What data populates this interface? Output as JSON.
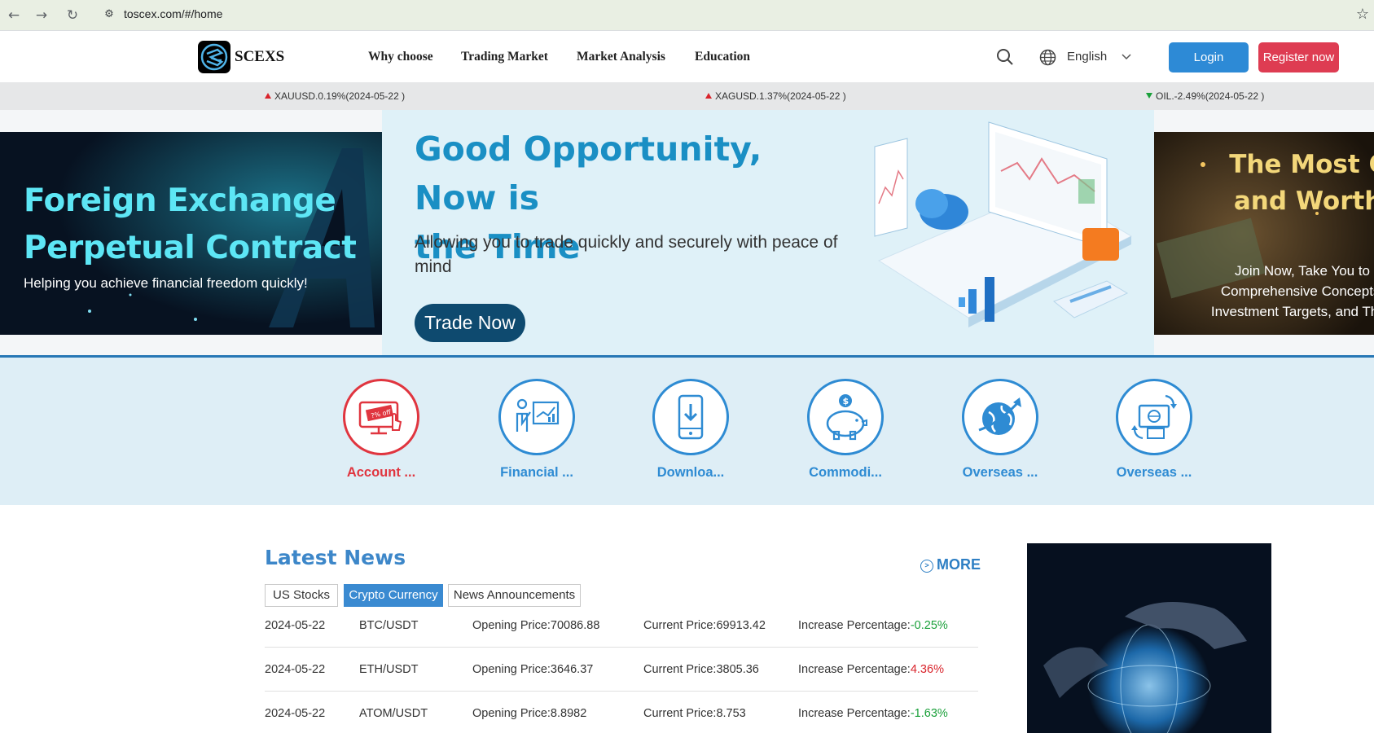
{
  "browser": {
    "url": "toscex.com/#/home",
    "back_icon": "back-arrow-icon",
    "forward_icon": "forward-arrow-icon",
    "reload_icon": "reload-icon",
    "site_info_icon": "tune-icon",
    "bookmark_icon": "star-icon"
  },
  "header": {
    "logo_text": "SCEXS",
    "nav": [
      "Why choose",
      "Trading Market",
      "Market Analysis",
      "Education"
    ],
    "language": "English",
    "login_label": "Login",
    "register_label": "Register now",
    "colors": {
      "login": "#2d8ad6",
      "register": "#de3c52"
    }
  },
  "ticker": [
    {
      "text": "XAUUSD.0.19%(2024-05-22 )",
      "direction": "up"
    },
    {
      "text": "XAGUSD.1.37%(2024-05-22 )",
      "direction": "up"
    },
    {
      "text": "OIL.-2.49%(2024-05-22 )",
      "direction": "down"
    }
  ],
  "banners": {
    "left": {
      "title_line1": "Foreign Exchange",
      "title_line2": "Perpetual Contract",
      "subtitle": "Helping you achieve financial freedom quickly!"
    },
    "center": {
      "title_line1": "Good Opportunity, Now is",
      "title_line2": "the Time",
      "subtitle": "Allowing you to trade quickly and securely with peace of mind",
      "button": "Trade Now"
    },
    "right": {
      "title_line1": "The Most Com",
      "title_line2": "and Worthy C",
      "sub_line1": "Join Now, Take You to",
      "sub_line2": "Comprehensive Concepts,",
      "sub_line3": "Investment Targets, and Their"
    }
  },
  "quick_links": [
    {
      "label": "Account ...",
      "icon": "discount-screen-icon",
      "color": "#e0353f"
    },
    {
      "label": "Financial ...",
      "icon": "presentation-chart-icon",
      "color": "#2e8bd3"
    },
    {
      "label": "Downloa...",
      "icon": "mobile-download-icon",
      "color": "#2e8bd3"
    },
    {
      "label": "Commodi...",
      "icon": "piggy-bank-icon",
      "color": "#2e8bd3"
    },
    {
      "label": "Overseas ...",
      "icon": "globe-arrow-icon",
      "color": "#2e8bd3"
    },
    {
      "label": "Overseas ...",
      "icon": "money-exchange-icon",
      "color": "#2e8bd3"
    }
  ],
  "news": {
    "title": "Latest News",
    "more": "MORE",
    "tabs": [
      "US Stocks",
      "Crypto Currency",
      "News Announcements"
    ],
    "active_tab": "Crypto Currency",
    "rows": [
      {
        "date": "2024-05-22",
        "pair": "BTC/USDT",
        "open": "Opening Price:70086.88",
        "current": "Current Price:69913.42",
        "inc_label": "Increase Percentage:",
        "inc_value": "-0.25%"
      },
      {
        "date": "2024-05-22",
        "pair": "ETH/USDT",
        "open": "Opening Price:3646.37",
        "current": "Current Price:3805.36",
        "inc_label": "Increase Percentage:",
        "inc_value": "4.36%"
      },
      {
        "date": "2024-05-22",
        "pair": "ATOM/USDT",
        "open": "Opening Price:8.8982",
        "current": "Current Price:8.753",
        "inc_label": "Increase Percentage:",
        "inc_value": "-1.63%"
      }
    ]
  }
}
